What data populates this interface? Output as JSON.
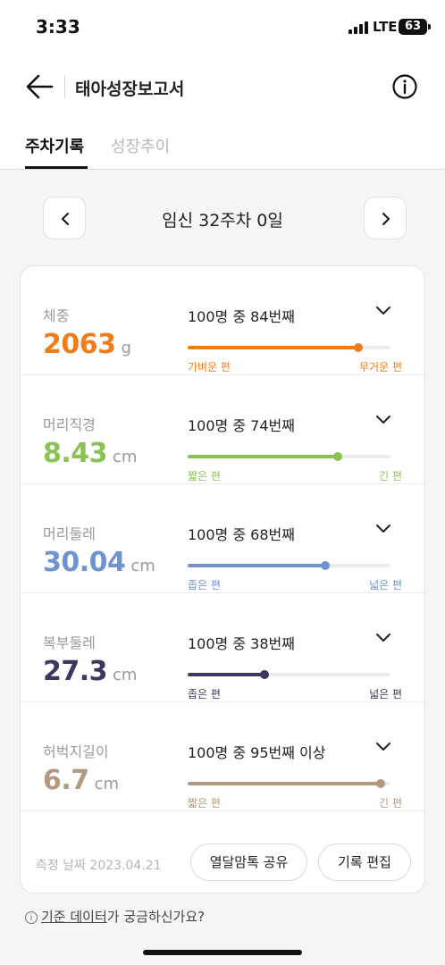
{
  "status_bar": {
    "time": "3:33",
    "network": "LTE",
    "battery": "63"
  },
  "header": {
    "title": "태아성장보고서",
    "back_icon": "arrow-left-icon",
    "info_icon": "info-circle-icon"
  },
  "tabs": [
    {
      "label": "주차기록",
      "active": true
    },
    {
      "label": "성장추이",
      "active": false
    }
  ],
  "week_nav": {
    "label": "임신 32주차 0일",
    "prev_icon": "chevron-left-icon",
    "next_icon": "chevron-right-icon"
  },
  "measurements": [
    {
      "label": "체중",
      "value": "2063",
      "unit": "g",
      "rank": "100명 중 84번째",
      "percentile": 84,
      "left_caption": "가벼운 편",
      "right_caption": "무거운 편",
      "color": "#f07d1a"
    },
    {
      "label": "머리직경",
      "value": "8.43",
      "unit": "cm",
      "rank": "100명 중 74번째",
      "percentile": 74,
      "left_caption": "짧은 편",
      "right_caption": "긴 편",
      "color": "#8cc153"
    },
    {
      "label": "머리둘레",
      "value": "30.04",
      "unit": "cm",
      "rank": "100명 중 68번째",
      "percentile": 68,
      "left_caption": "좁은 편",
      "right_caption": "넓은 편",
      "color": "#6f93cf"
    },
    {
      "label": "복부둘레",
      "value": "27.3",
      "unit": "cm",
      "rank": "100명 중 38번째",
      "percentile": 38,
      "left_caption": "좁은 편",
      "right_caption": "넓은 편",
      "color": "#3b3a5e"
    },
    {
      "label": "허벅지길이",
      "value": "6.7",
      "unit": "cm",
      "rank": "100명 중 95번째 이상",
      "percentile": 95,
      "left_caption": "짧은 편",
      "right_caption": "긴 편",
      "color": "#b39880"
    }
  ],
  "footer": {
    "date": "측정 날짜 2023.04.21",
    "share_label": "열달맘톡 공유",
    "edit_label": "기록 편집"
  },
  "help": {
    "link_text": "기준 데이터",
    "rest_text": "가 궁금하신가요?",
    "icon": "info-circle-icon"
  }
}
